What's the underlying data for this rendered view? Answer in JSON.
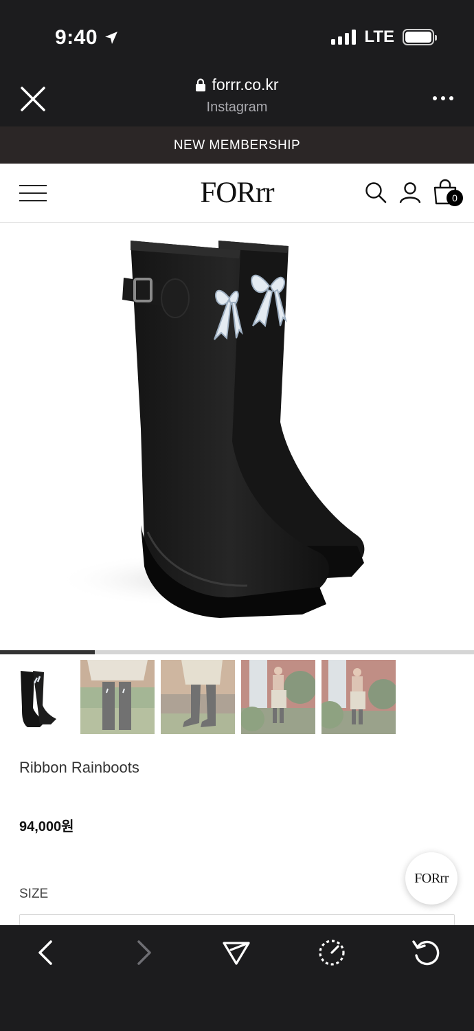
{
  "status_bar": {
    "time": "9:40",
    "network": "LTE"
  },
  "browser": {
    "domain": "forrr.co.kr",
    "source": "Instagram"
  },
  "site": {
    "banner": "NEW MEMBERSHIP",
    "logo": "FORrr",
    "cart_count": "0"
  },
  "gallery": {
    "slide_index": 1,
    "slide_total": 5
  },
  "product": {
    "name": "Ribbon Rainboots",
    "price": "94,000원",
    "size_label": "SIZE"
  },
  "chat_button": {
    "label": "FORrr"
  },
  "icons": {
    "close": "close-icon",
    "lock": "lock-icon",
    "more": "more-icon",
    "menu": "hamburger-icon",
    "search": "search-icon",
    "account": "user-icon",
    "cart": "cart-icon",
    "back": "back-icon",
    "forward": "forward-icon",
    "share": "send-icon",
    "speed": "gauge-icon",
    "reload": "reload-icon"
  },
  "colors": {
    "chrome": "#1c1c1e",
    "banner": "#2b2626",
    "page": "#ffffff",
    "text": "#111111"
  }
}
